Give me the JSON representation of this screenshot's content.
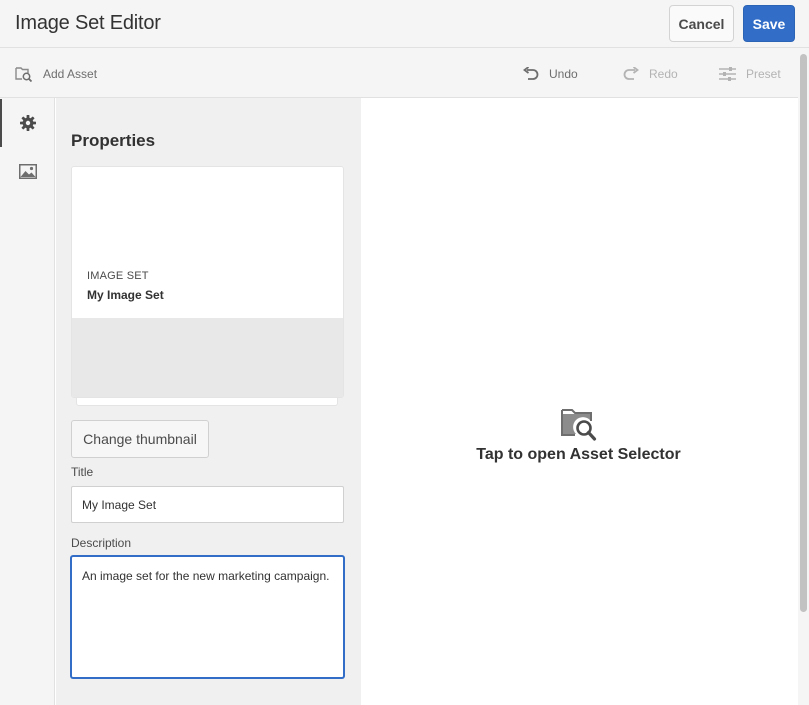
{
  "header": {
    "title": "Image Set Editor",
    "cancel_label": "Cancel",
    "save_label": "Save"
  },
  "toolbar": {
    "add_asset": "Add Asset",
    "undo": "Undo",
    "redo": "Redo",
    "preset": "Preset"
  },
  "rail": {
    "items": [
      {
        "icon": "gear-icon",
        "active": true
      },
      {
        "icon": "image-icon",
        "active": false
      }
    ]
  },
  "properties": {
    "heading": "Properties",
    "card": {
      "kind": "IMAGE SET",
      "name": "My Image Set"
    },
    "change_thumbnail_label": "Change thumbnail",
    "title_label": "Title",
    "title_value": "My Image Set",
    "description_label": "Description",
    "description_value": "An image set for the new marketing campaign."
  },
  "main": {
    "asset_selector_prompt": "Tap to open Asset Selector",
    "icon": "folder-search-icon"
  },
  "colors": {
    "accent": "#326ec8",
    "panel_bg": "#f0f0f0",
    "header_bg": "#f5f5f5"
  }
}
